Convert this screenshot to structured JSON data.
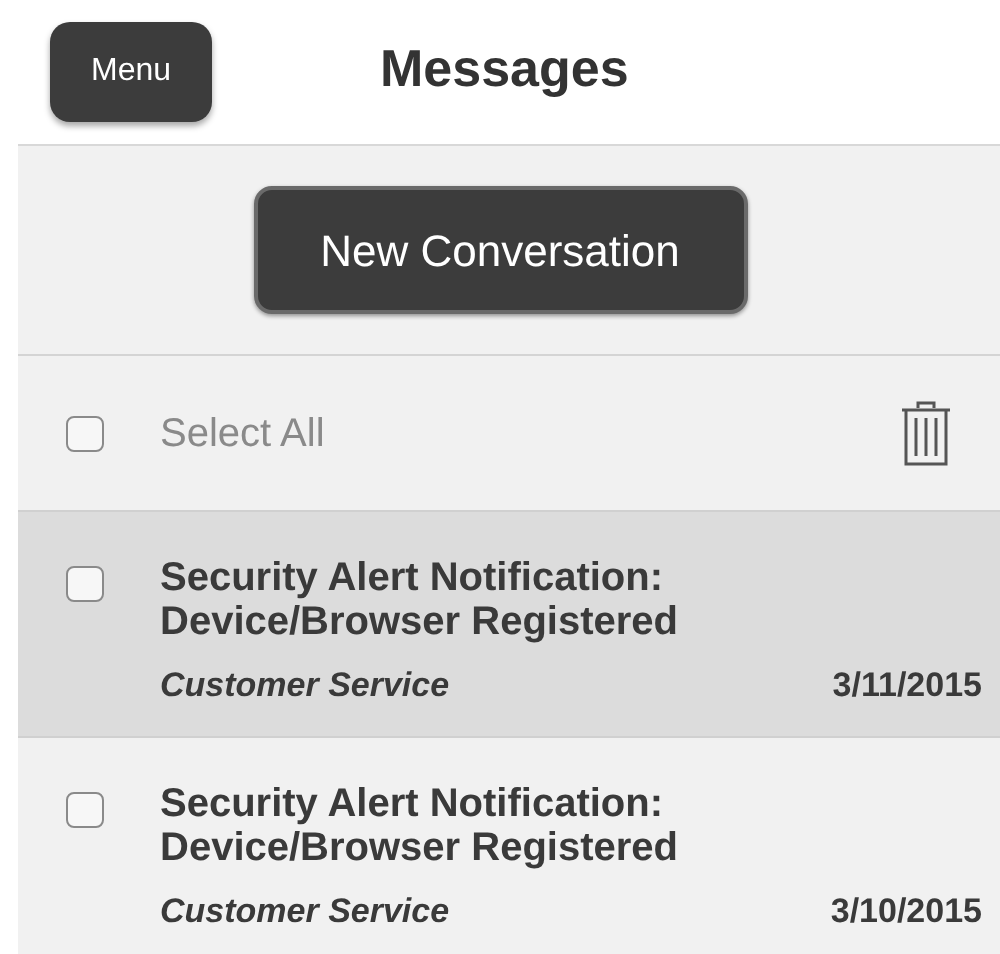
{
  "header": {
    "menu_button": "Menu",
    "title": "Messages"
  },
  "new_conversation_button": "New Conversation",
  "select_all": {
    "label": "Select All",
    "checked": false
  },
  "messages": [
    {
      "subject": "Security Alert Notification: Device/Browser Registered",
      "sender": "Customer Service",
      "date": "3/11/2015",
      "selected": true,
      "checked": false
    },
    {
      "subject": "Security Alert Notification: Device/Browser Registered",
      "sender": "Customer Service",
      "date": "3/10/2015",
      "selected": false,
      "checked": false
    }
  ]
}
